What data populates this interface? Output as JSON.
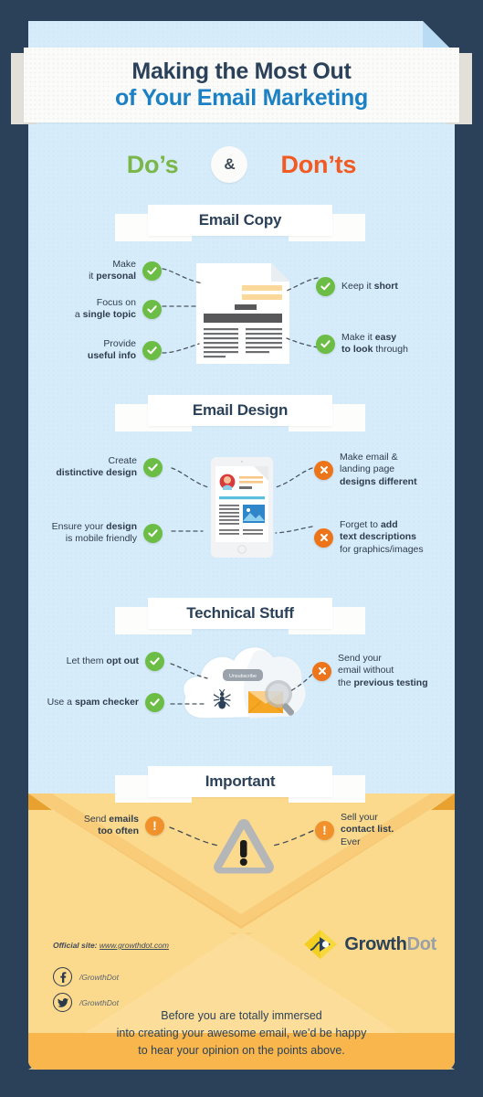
{
  "title": {
    "line1": "Making the Most Out",
    "line2": "of Your Email Marketing"
  },
  "dos_donts": {
    "dos": "Do’s",
    "amp": "&",
    "donts": "Don’ts"
  },
  "colors": {
    "frame": "#2b4159",
    "page": "#d7ecfa",
    "navy": "#2b4159",
    "blue": "#1b81c4",
    "green": "#6cbd45",
    "green_text": "#7ab64a",
    "orange": "#f15a22",
    "orange_badge": "#ee7419",
    "warn_badge": "#f0912b",
    "envelope": "#fbd98d",
    "envelope_dark": "#f8b64c",
    "logo_yellow": "#f2cf21"
  },
  "sections": [
    {
      "id": "email-copy",
      "heading": "Email Copy",
      "left_items": [
        {
          "type": "ok",
          "lines": [
            {
              "plain": "Make",
              "bold": ""
            },
            {
              "plain": "it ",
              "bold": "personal"
            }
          ]
        },
        {
          "type": "ok",
          "lines": [
            {
              "plain": "Focus on",
              "bold": ""
            },
            {
              "plain": "a ",
              "bold": "single topic"
            }
          ]
        },
        {
          "type": "ok",
          "lines": [
            {
              "plain": "Provide",
              "bold": ""
            },
            {
              "plain": "",
              "bold": "useful info"
            }
          ]
        }
      ],
      "right_items": [
        {
          "type": "ok",
          "lines": [
            {
              "plain": "Keep it ",
              "bold": "short"
            }
          ]
        },
        {
          "type": "ok",
          "lines": [
            {
              "plain": "Make it ",
              "bold": "easy"
            },
            {
              "plain": "",
              "bold": "to look",
              "tail": " through"
            }
          ]
        }
      ]
    },
    {
      "id": "email-design",
      "heading": "Email Design",
      "left_items": [
        {
          "type": "ok",
          "lines": [
            {
              "plain": "Create",
              "bold": ""
            },
            {
              "plain": "",
              "bold": "distinctive design"
            }
          ]
        },
        {
          "type": "ok",
          "lines": [
            {
              "plain": "Ensure your ",
              "bold": "design"
            },
            {
              "plain": "is mobile friendly",
              "bold": ""
            }
          ]
        }
      ],
      "right_items": [
        {
          "type": "no",
          "lines": [
            {
              "plain": "Make email &",
              "bold": ""
            },
            {
              "plain": "landing page",
              "bold": ""
            },
            {
              "plain": "",
              "bold": "designs different"
            }
          ]
        },
        {
          "type": "no",
          "lines": [
            {
              "plain": "Forget to ",
              "bold": "add"
            },
            {
              "plain": "",
              "bold": "text descriptions"
            },
            {
              "plain": "for graphics/images",
              "bold": ""
            }
          ]
        }
      ]
    },
    {
      "id": "technical-stuff",
      "heading": "Technical Stuff",
      "left_items": [
        {
          "type": "ok",
          "lines": [
            {
              "plain": "Let them ",
              "bold": "opt out"
            }
          ]
        },
        {
          "type": "ok",
          "lines": [
            {
              "plain": "Use a ",
              "bold": "spam checker"
            }
          ]
        }
      ],
      "right_items": [
        {
          "type": "no",
          "lines": [
            {
              "plain": "Send your",
              "bold": ""
            },
            {
              "plain": "email without",
              "bold": ""
            },
            {
              "plain": "the ",
              "bold": "previous testing"
            }
          ]
        }
      ]
    },
    {
      "id": "important",
      "heading": "Important",
      "left_items": [
        {
          "type": "warn",
          "lines": [
            {
              "plain": "Send ",
              "bold": "emails"
            },
            {
              "plain": "",
              "bold": "too often"
            }
          ]
        }
      ],
      "right_items": [
        {
          "type": "warn",
          "lines": [
            {
              "plain": "Sell your",
              "bold": ""
            },
            {
              "plain": "",
              "bold": "contact list."
            },
            {
              "plain": "Ever",
              "bold": ""
            }
          ]
        }
      ]
    }
  ],
  "illustrations": {
    "unsubscribe_chip": "Unsubscribe"
  },
  "footer": {
    "site_label": "Official site:",
    "site_url": "www.growthdot.com",
    "facebook_handle": "/GrowthDot",
    "twitter_handle": "/GrowthDot",
    "closing_line1": "Before you are totally immersed",
    "closing_line2": "into creating your awesome email, we’d be happy",
    "closing_line3": "to hear your opinion on the points above.",
    "brand_part1": "Growth",
    "brand_part2": "Dot"
  }
}
